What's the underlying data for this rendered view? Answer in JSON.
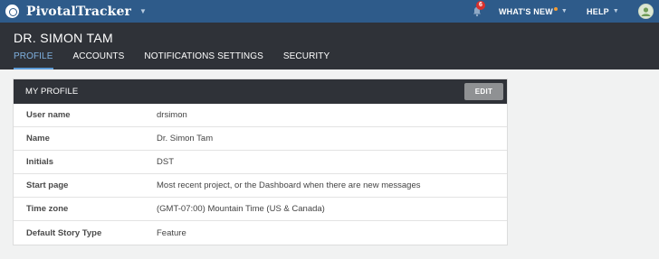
{
  "topbar": {
    "brand": "PivotalTracker",
    "notifications_count": "6",
    "whats_new": "WHAT'S NEW",
    "help": "HELP"
  },
  "header": {
    "user": "DR. SIMON TAM",
    "tabs": [
      {
        "label": "PROFILE",
        "active": true
      },
      {
        "label": "ACCOUNTS"
      },
      {
        "label": "NOTIFICATIONS SETTINGS"
      },
      {
        "label": "SECURITY"
      }
    ]
  },
  "profile": {
    "title": "MY PROFILE",
    "edit_label": "EDIT",
    "rows": [
      {
        "label": "User name",
        "value": "drsimon"
      },
      {
        "label": "Name",
        "value": "Dr. Simon Tam"
      },
      {
        "label": "Initials",
        "value": "DST"
      },
      {
        "label": "Start page",
        "value": "Most recent project, or the Dashboard when there are new messages"
      },
      {
        "label": "Time zone",
        "value": "(GMT-07:00) Mountain Time (US & Canada)"
      },
      {
        "label": "Default Story Type",
        "value": "Feature"
      }
    ]
  },
  "colors": {
    "topbar": "#2e5b8a",
    "header": "#2f3238",
    "active_tab": "#7fb1e0",
    "badge": "#d9302c"
  }
}
